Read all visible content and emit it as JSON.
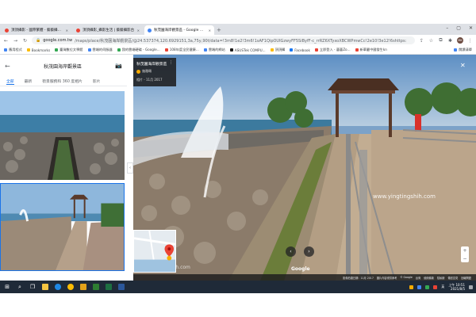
{
  "browser": {
    "tabs": [
      {
        "title": "頂頂攝影 - 國際繁體 - 藝藝攝影台"
      },
      {
        "title": "頂頂攝影_攝影生活 | 藝藝攝影台"
      },
      {
        "title": "秋茂園海岸觀景區 - Google 地圖",
        "active": true
      }
    ],
    "new_tab": "+",
    "url_host": "google.com.tw",
    "url_path": "/maps/place/秋茂園海岸觀景區/@24.537374,120.6929151,3a,75y,90t/data=!3m8!1e2!3m6!1sAF1QipOUIGzwyFF5SiByfF-c_rrRZ6XTyxoXBCWPmwCc!2e10!3e12!6shttps:",
    "bookmarks": [
      {
        "label": "應用程式",
        "color": "#4285f4"
      },
      {
        "label": "Bookmarks",
        "color": "#fbbc04"
      },
      {
        "label": "臺灣數位文學館",
        "color": "#34a853"
      },
      {
        "label": "雲端的伺服器",
        "color": "#4285f4"
      },
      {
        "label": "我的雲端硬碟 - Google...",
        "color": "#34a853"
      },
      {
        "label": "108年度全民健康...",
        "color": "#ea4335"
      },
      {
        "label": "雲端的網站",
        "color": "#4285f4"
      },
      {
        "label": "ASUSTek COMPU...",
        "color": "#1a1a1a"
      },
      {
        "label": "頂頂攝",
        "color": "#fbbc04"
      },
      {
        "label": "Facebook",
        "color": "#1877f2"
      },
      {
        "label": "立即登入 - 藝藝Zo...",
        "color": "#ea4335"
      },
      {
        "label": "新華嚴中國發生kn",
        "color": "#ea4335"
      }
    ],
    "bookmarks_right": "閱讀清單",
    "avatar_text": "MK"
  },
  "left_panel": {
    "title": "秋茂園海岸觀景區",
    "tabs": [
      {
        "label": "全部",
        "active": true
      },
      {
        "label": "最新"
      },
      {
        "label": "街景服務和 360 度相片"
      },
      {
        "label": "影片"
      }
    ]
  },
  "viewer": {
    "place_name": "秋茂園海岸觀景區",
    "user_name": "施雅頤",
    "date": "相片 - 11月 2017",
    "watermark": "www.yingtingshih.com",
    "watermark2": "jeh.com",
    "google_logo": "Google",
    "footer": [
      "影像拍攝日期：11月 2017",
      "圖片內容僅供參考",
      "© Google",
      "台灣",
      "使用條款",
      "隱私權",
      "傳送意見",
      "回報問題"
    ]
  },
  "taskbar": {
    "tray_text": "英",
    "time": "上午 10:51",
    "date": "2021/8/5"
  },
  "colors": {
    "accent": "#1a73e8",
    "taskbar": "#1f2a38"
  }
}
